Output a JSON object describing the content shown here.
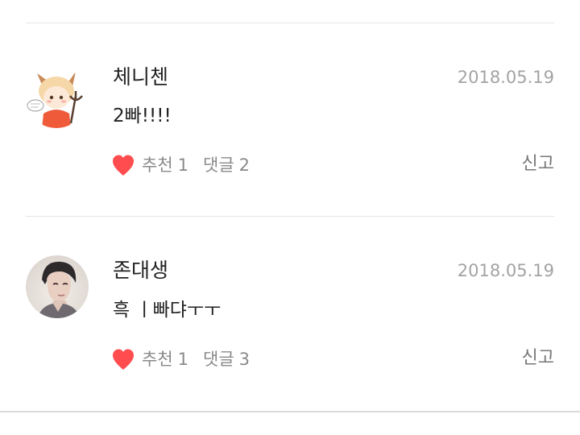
{
  "comments": [
    {
      "nickname": "체니첸",
      "date": "2018.05.19",
      "text": "2빠!!!!",
      "like_label": "추천",
      "like_count": "1",
      "reply_label": "댓글",
      "reply_count": "2",
      "report_label": "신고",
      "avatar_icon": "devil-chibi-avatar"
    },
    {
      "nickname": "존대생",
      "date": "2018.05.19",
      "text": "흑 ㅣ빠댜ㅜㅜ",
      "like_label": "추천",
      "like_count": "1",
      "reply_label": "댓글",
      "reply_count": "3",
      "report_label": "신고",
      "avatar_icon": "profile-photo-avatar"
    }
  ],
  "colors": {
    "heart": "#ff4d4f",
    "date": "#a3a3a3",
    "divider": "#e6e6e6"
  }
}
